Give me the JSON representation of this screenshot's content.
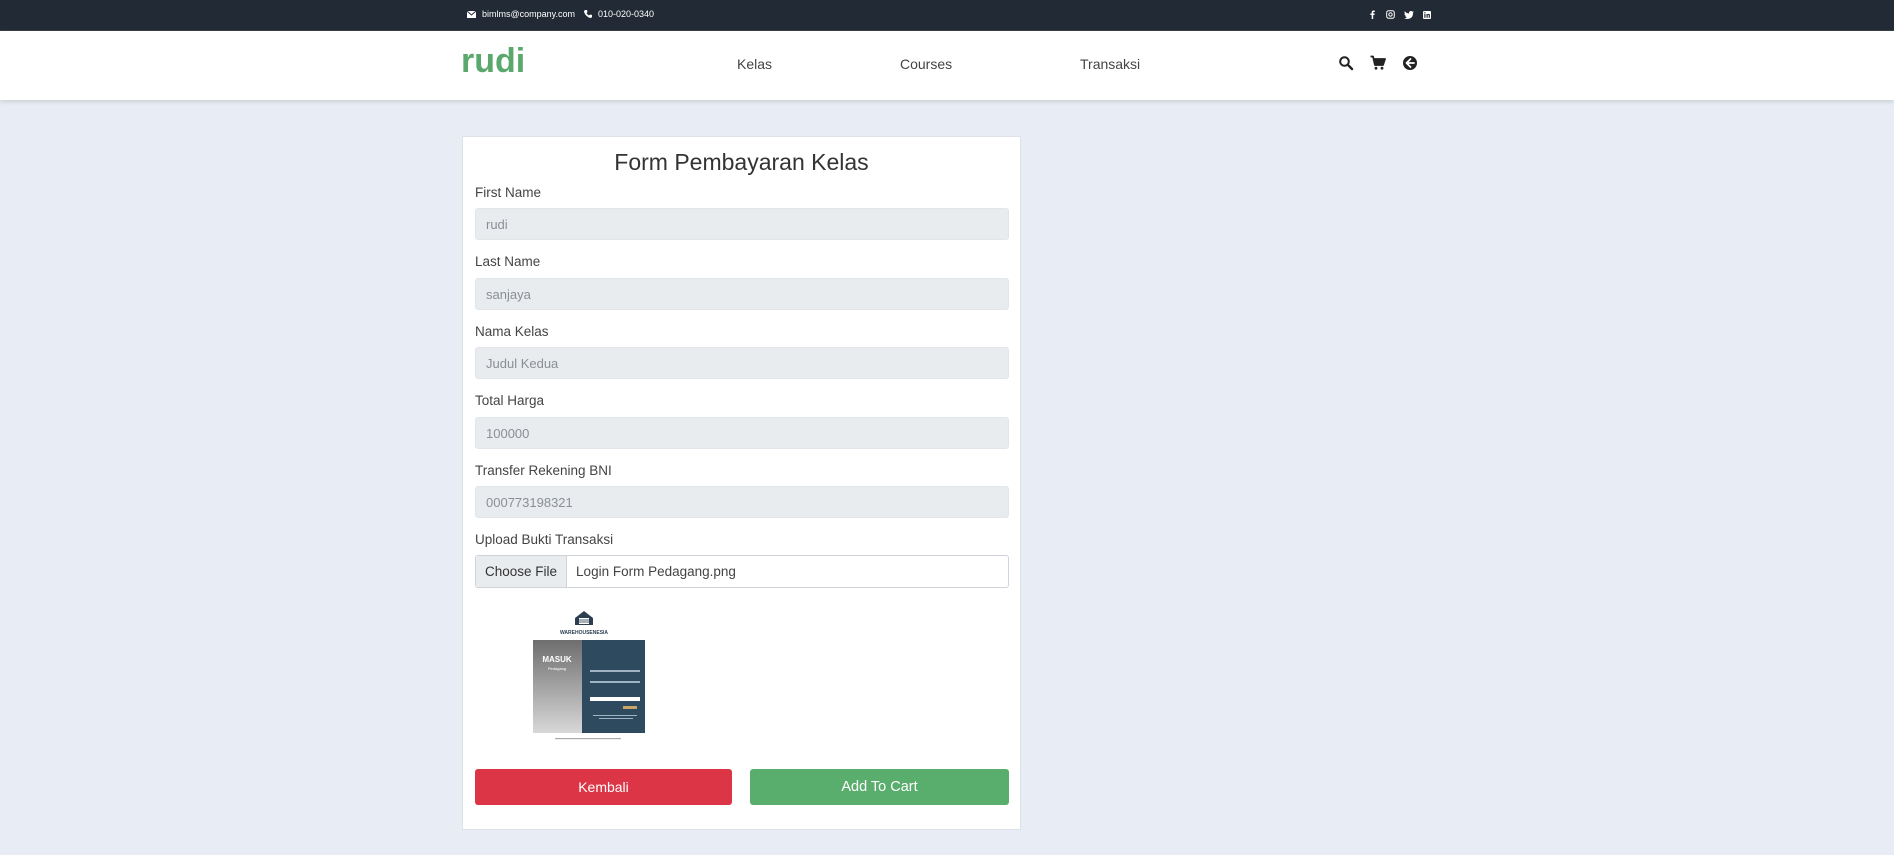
{
  "topbar": {
    "email": "bimlms@company.com",
    "phone": "010-020-0340",
    "social": [
      "facebook-icon",
      "instagram-icon",
      "twitter-icon",
      "linkedin-icon"
    ]
  },
  "navbar": {
    "brand": "rudi",
    "links": [
      "Kelas",
      "Courses",
      "Transaksi"
    ],
    "icons": [
      "search-icon",
      "cart-icon",
      "back-circle-icon"
    ]
  },
  "form": {
    "title": "Form Pembayaran Kelas",
    "first_name": {
      "label": "First Name",
      "value": "rudi"
    },
    "last_name": {
      "label": "Last Name",
      "value": "sanjaya"
    },
    "nama_kelas": {
      "label": "Nama Kelas",
      "value": "Judul Kedua"
    },
    "total_harga": {
      "label": "Total Harga",
      "value": "100000"
    },
    "rekening": {
      "label": "Transfer Rekening BNI",
      "value": "000773198321"
    },
    "upload": {
      "label": "Upload Bukti Transaksi",
      "button": "Choose File",
      "filename": "Login Form Pedagang.png"
    },
    "preview": {
      "brand": "WAREHOUSENESIA",
      "heading": "MASUK",
      "subheading": "Pedagang"
    },
    "buttons": {
      "back": "Kembali",
      "cart": "Add To Cart"
    }
  },
  "colors": {
    "brand": "#5aa86c",
    "topbar": "#222a35",
    "danger": "#dc3545",
    "success": "#5aae6d",
    "background": "#e8edf5"
  }
}
